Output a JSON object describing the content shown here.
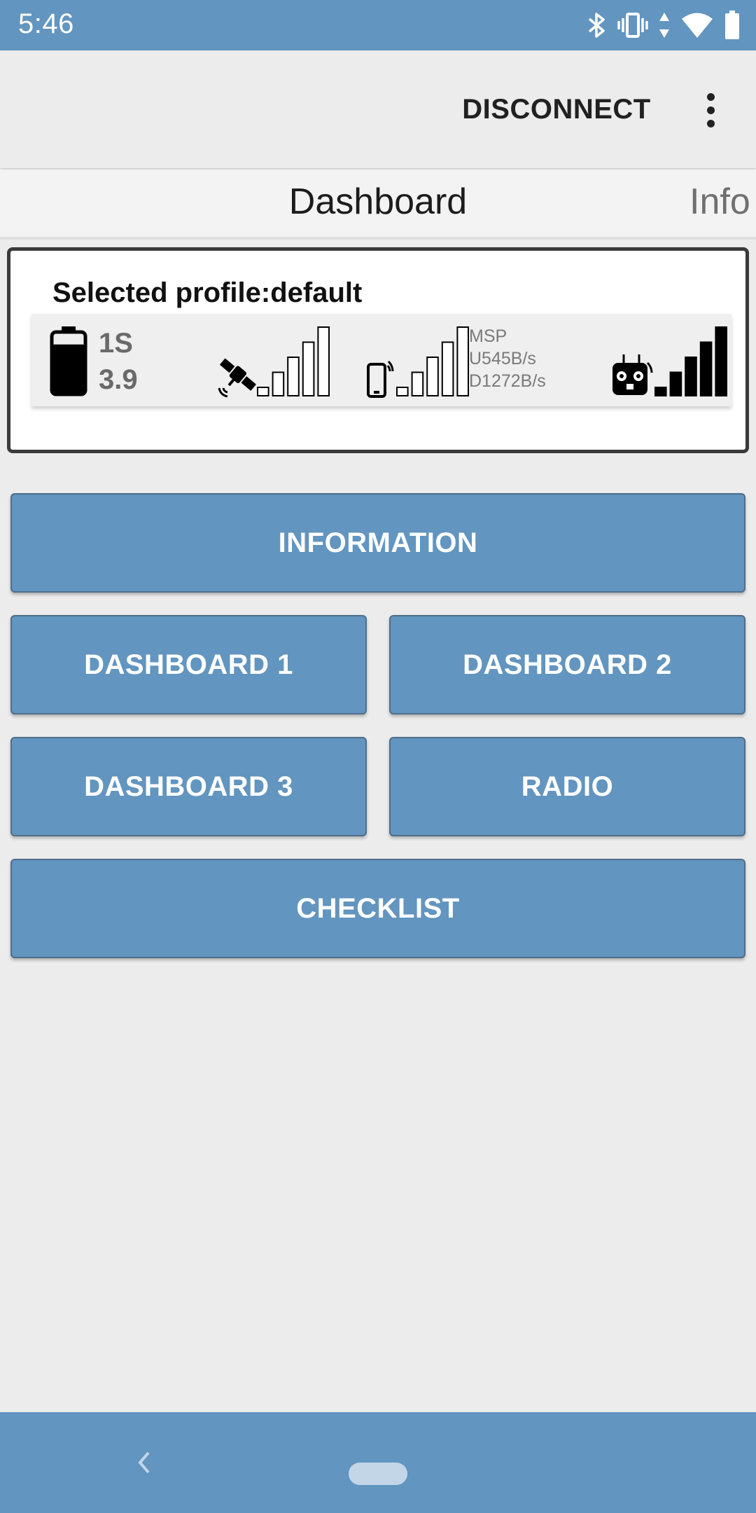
{
  "status_bar": {
    "time": "5:46",
    "icons": [
      "bluetooth-icon",
      "vibrate-icon",
      "data-arrows-icon",
      "wifi-icon",
      "battery-icon"
    ],
    "background": "#6295bf"
  },
  "toolbar": {
    "action_label": "DISCONNECT",
    "menu_icon": "more-vert-icon"
  },
  "tabs": {
    "current": "Dashboard",
    "next": "Info"
  },
  "profile_card": {
    "label": "Selected profile:default",
    "battery": {
      "cells": "1S",
      "voltage": "3.9",
      "level": 0.8
    },
    "gps": {
      "icon": "satellite-icon",
      "signal_bars_filled": 0,
      "signal_bars_total": 5
    },
    "link": {
      "icon": "phone-signal-icon",
      "signal_bars_filled": 0,
      "signal_bars_total": 5,
      "protocol": "MSP",
      "upload": "U545B/s",
      "download": "D1272B/s"
    },
    "radio": {
      "icon": "rc-transmitter-icon",
      "signal_bars_filled": 5,
      "signal_bars_total": 5
    }
  },
  "buttons": {
    "information": "INFORMATION",
    "dashboard1": "DASHBOARD 1",
    "dashboard2": "DASHBOARD 2",
    "dashboard3": "DASHBOARD 3",
    "radio": "RADIO",
    "checklist": "CHECKLIST"
  },
  "colors": {
    "accent": "#6295bf",
    "button_border": "#4e6e8a",
    "background": "#ececec"
  },
  "nav_bar": {
    "back_icon": "back-chevron-icon",
    "home_icon": "home-pill-icon"
  }
}
